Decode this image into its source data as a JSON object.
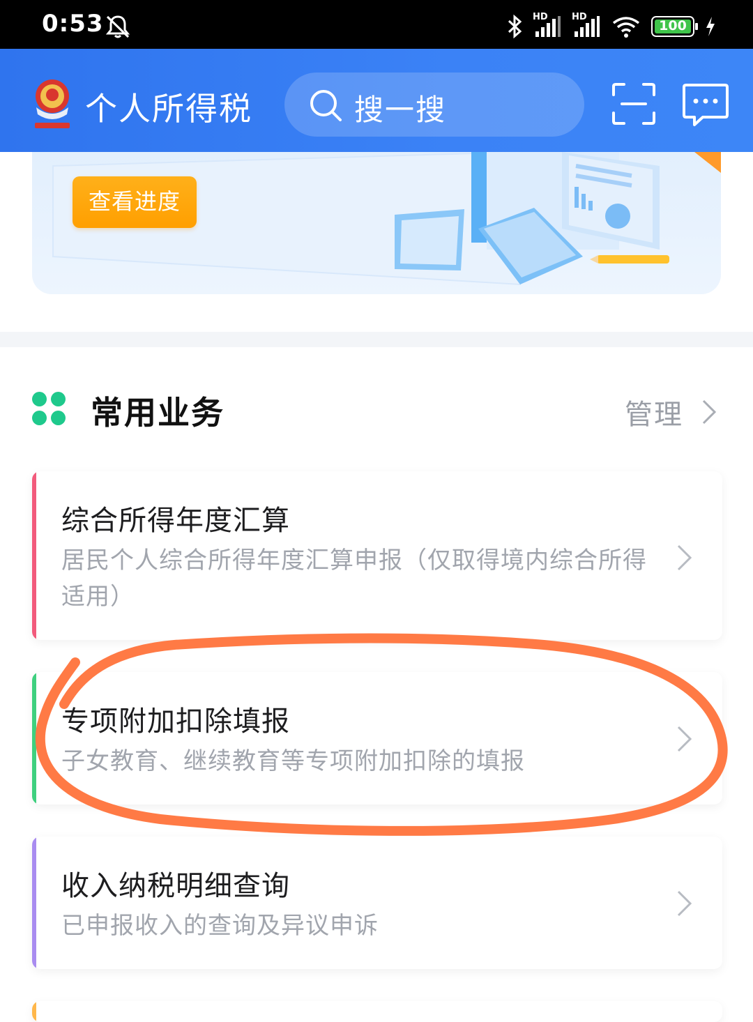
{
  "status_bar": {
    "time": "0:53",
    "network_label": "HD",
    "battery": "100"
  },
  "header": {
    "app_title": "个人所得税",
    "search_placeholder": "搜一搜"
  },
  "banner": {
    "button_label": "查看进度"
  },
  "section": {
    "title": "常用业务",
    "manage_label": "管理"
  },
  "cards": [
    {
      "title": "综合所得年度汇算",
      "desc": "居民个人综合所得年度汇算申报（仅取得境内综合所得适用）",
      "accent": "#f25b7c"
    },
    {
      "title": "专项附加扣除填报",
      "desc": "子女教育、继续教育等专项附加扣除的填报",
      "accent": "#3fd07f"
    },
    {
      "title": "收入纳税明细查询",
      "desc": "已申报收入的查询及异议申诉",
      "accent": "#a98cf0"
    }
  ],
  "colors": {
    "header_blue": "#3b82f6",
    "orange_button": "#ffa50a",
    "annotation": "#ff7a45",
    "green_icon": "#1fc98c"
  }
}
